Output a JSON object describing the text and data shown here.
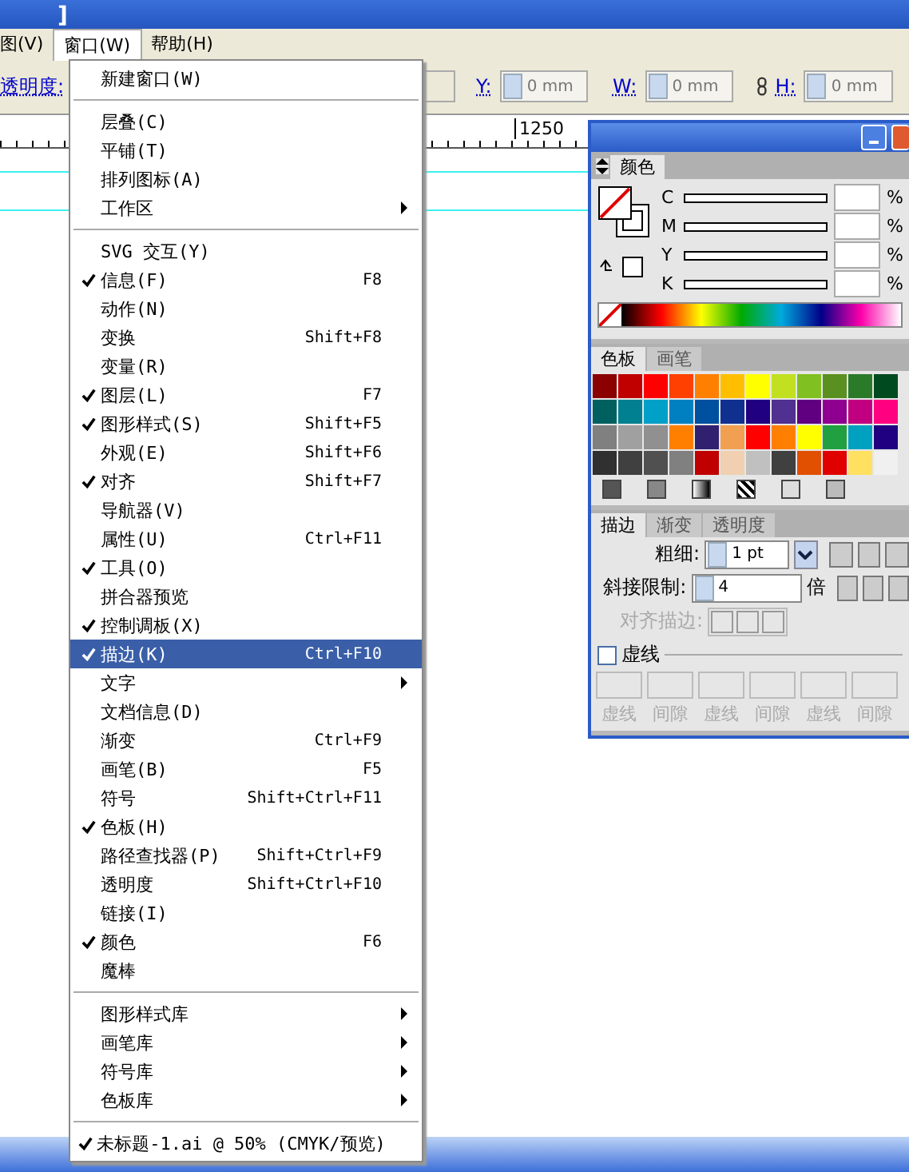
{
  "title_bar": {
    "title": "]"
  },
  "menubar": [
    {
      "label": "图(V)",
      "selected": false
    },
    {
      "label": "窗口(W)",
      "selected": true
    },
    {
      "label": "帮助(H)",
      "selected": false
    }
  ],
  "control_bar": {
    "opacity_label": "透明度:",
    "fields": [
      {
        "label": "Y:",
        "value": "0 mm"
      },
      {
        "label": "W:",
        "value": "0 mm"
      },
      {
        "label": "H:",
        "value": "0 mm"
      }
    ]
  },
  "ruler": {
    "labels": [
      "1250"
    ]
  },
  "menu": {
    "sections": [
      [
        {
          "label": "新建窗口(W)",
          "checked": false,
          "submenu": false,
          "selected": false
        }
      ],
      [
        {
          "label": "层叠(C)",
          "checked": false,
          "submenu": false,
          "selected": false
        },
        {
          "label": "平铺(T)",
          "checked": false,
          "submenu": false,
          "selected": false
        },
        {
          "label": "排列图标(A)",
          "checked": false,
          "submenu": false,
          "selected": false
        },
        {
          "label": "工作区",
          "checked": false,
          "submenu": true,
          "selected": false
        }
      ],
      [
        {
          "label": "SVG 交互(Y)",
          "checked": false,
          "submenu": false,
          "selected": false
        },
        {
          "label": "信息(F)",
          "shortcut": "F8",
          "checked": true,
          "submenu": false,
          "selected": false
        },
        {
          "label": "动作(N)",
          "checked": false,
          "submenu": false,
          "selected": false
        },
        {
          "label": "变换",
          "shortcut": "Shift+F8",
          "checked": false,
          "submenu": false,
          "selected": false
        },
        {
          "label": "变量(R)",
          "checked": false,
          "submenu": false,
          "selected": false
        },
        {
          "label": "图层(L)",
          "shortcut": "F7",
          "checked": true,
          "submenu": false,
          "selected": false
        },
        {
          "label": "图形样式(S)",
          "shortcut": "Shift+F5",
          "checked": true,
          "submenu": false,
          "selected": false
        },
        {
          "label": "外观(E)",
          "shortcut": "Shift+F6",
          "checked": false,
          "submenu": false,
          "selected": false
        },
        {
          "label": "对齐",
          "shortcut": "Shift+F7",
          "checked": true,
          "submenu": false,
          "selected": false
        },
        {
          "label": "导航器(V)",
          "checked": false,
          "submenu": false,
          "selected": false
        },
        {
          "label": "属性(U)",
          "shortcut": "Ctrl+F11",
          "checked": false,
          "submenu": false,
          "selected": false
        },
        {
          "label": "工具(O)",
          "checked": true,
          "submenu": false,
          "selected": false
        },
        {
          "label": "拼合器预览",
          "checked": false,
          "submenu": false,
          "selected": false
        },
        {
          "label": "控制调板(X)",
          "checked": true,
          "submenu": false,
          "selected": false
        },
        {
          "label": "描边(K)",
          "shortcut": "Ctrl+F10",
          "checked": true,
          "submenu": false,
          "selected": true
        },
        {
          "label": "文字",
          "checked": false,
          "submenu": true,
          "selected": false
        },
        {
          "label": "文档信息(D)",
          "checked": false,
          "submenu": false,
          "selected": false
        },
        {
          "label": "渐变",
          "shortcut": "Ctrl+F9",
          "checked": false,
          "submenu": false,
          "selected": false
        },
        {
          "label": "画笔(B)",
          "shortcut": "F5",
          "checked": false,
          "submenu": false,
          "selected": false
        },
        {
          "label": "符号",
          "shortcut": "Shift+Ctrl+F11",
          "checked": false,
          "submenu": false,
          "selected": false
        },
        {
          "label": "色板(H)",
          "checked": true,
          "submenu": false,
          "selected": false
        },
        {
          "label": "路径查找器(P)",
          "shortcut": "Shift+Ctrl+F9",
          "checked": false,
          "submenu": false,
          "selected": false
        },
        {
          "label": "透明度",
          "shortcut": "Shift+Ctrl+F10",
          "checked": false,
          "submenu": false,
          "selected": false
        },
        {
          "label": "链接(I)",
          "checked": false,
          "submenu": false,
          "selected": false
        },
        {
          "label": "颜色",
          "shortcut": "F6",
          "checked": true,
          "submenu": false,
          "selected": false
        },
        {
          "label": "魔棒",
          "checked": false,
          "submenu": false,
          "selected": false
        }
      ],
      [
        {
          "label": "图形样式库",
          "checked": false,
          "submenu": true,
          "selected": false
        },
        {
          "label": "画笔库",
          "checked": false,
          "submenu": true,
          "selected": false
        },
        {
          "label": "符号库",
          "checked": false,
          "submenu": true,
          "selected": false
        },
        {
          "label": "色板库",
          "checked": false,
          "submenu": true,
          "selected": false
        }
      ],
      [
        {
          "label": "未标题-1.ai @ 50% (CMYK/预览)",
          "checked": true,
          "submenu": false,
          "selected": false
        }
      ]
    ]
  },
  "color_panel": {
    "tab": "颜色",
    "channels": [
      {
        "name": "C",
        "unit": "%"
      },
      {
        "name": "M",
        "unit": "%"
      },
      {
        "name": "Y",
        "unit": "%"
      },
      {
        "name": "K",
        "unit": "%"
      }
    ]
  },
  "swatch_panel": {
    "tabs": [
      {
        "label": "色板",
        "selected": true
      },
      {
        "label": "画笔",
        "selected": false
      }
    ],
    "swatches": [
      {
        "color": "#8b0000"
      },
      {
        "color": "#c00000"
      },
      {
        "color": "#ff0000"
      },
      {
        "color": "#ff4000"
      },
      {
        "color": "#ff8000"
      },
      {
        "color": "#ffbf00"
      },
      {
        "color": "#ffff00"
      },
      {
        "color": "#c0e020"
      },
      {
        "color": "#80c020"
      },
      {
        "color": "#5a9020"
      },
      {
        "color": "#2a7a2a"
      },
      {
        "color": "#004a20"
      },
      {
        "color": "#006060"
      },
      {
        "color": "#008090"
      },
      {
        "color": "#00a0c8"
      },
      {
        "color": "#0080c0"
      },
      {
        "color": "#0050a0"
      },
      {
        "color": "#103090"
      },
      {
        "color": "#200080"
      },
      {
        "color": "#503090"
      },
      {
        "color": "#600080"
      },
      {
        "color": "#900090"
      },
      {
        "color": "#c00080"
      },
      {
        "color": "#ff0080"
      },
      {
        "color": "#808080"
      },
      {
        "color": "#a0a0a0"
      },
      {
        "color": "#909090"
      },
      {
        "color": "#ff8000"
      },
      {
        "color": "#302070"
      },
      {
        "color": "#f0a050"
      },
      {
        "color": "#ff0000"
      },
      {
        "color": "#ff8000"
      },
      {
        "color": "#ffff00"
      },
      {
        "color": "#20a040"
      },
      {
        "color": "#00a0c0"
      },
      {
        "color": "#200080"
      },
      {
        "color": "#303030"
      },
      {
        "color": "#404040"
      },
      {
        "color": "#505050"
      },
      {
        "color": "#808080"
      },
      {
        "color": "#c00000"
      },
      {
        "color": "#f0d0b0"
      },
      {
        "color": "#c0c0c0"
      },
      {
        "color": "#404040"
      },
      {
        "color": "#e05000"
      },
      {
        "color": "#e00000"
      },
      {
        "color": "#ffe060"
      },
      {
        "color": "#f0f0f0"
      }
    ]
  },
  "stroke_panel": {
    "tabs": [
      {
        "label": "描边",
        "selected": true
      },
      {
        "label": "渐变",
        "selected": false
      },
      {
        "label": "透明度",
        "selected": false
      }
    ],
    "weight": {
      "label": "粗细:",
      "value": "1 pt"
    },
    "miter": {
      "label": "斜接限制:",
      "value": "4",
      "unit": "倍"
    },
    "align": {
      "label": "对齐描边:",
      "disabled": true
    },
    "dashed": {
      "label": "虚线",
      "checked": false
    },
    "dash_fields": [
      "虚线",
      "间隙",
      "虚线",
      "间隙",
      "虚线",
      "间隙"
    ]
  }
}
